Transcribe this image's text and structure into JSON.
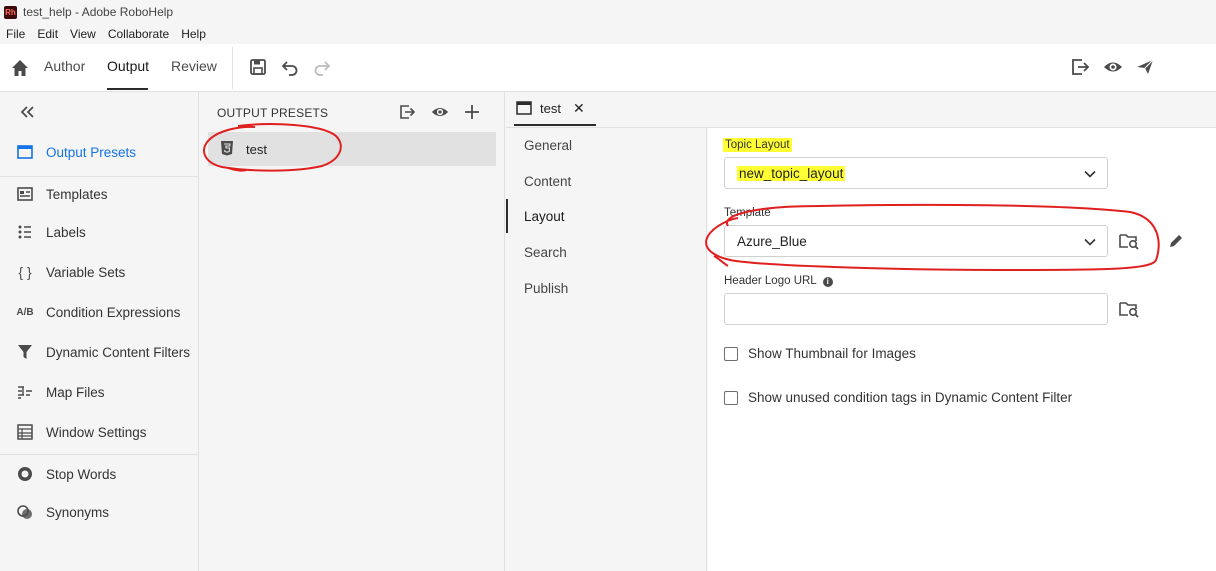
{
  "window": {
    "title": "test_help - Adobe RoboHelp",
    "logo_text": "Rh"
  },
  "menu": [
    "File",
    "Edit",
    "View",
    "Collaborate",
    "Help"
  ],
  "toolbar": {
    "tabs": [
      "Author",
      "Output",
      "Review"
    ],
    "active_tab": "Output"
  },
  "left_rail": {
    "items": [
      {
        "label": "Output Presets",
        "icon": "output-presets-icon",
        "active": true
      },
      {
        "label": "Templates",
        "icon": "templates-icon"
      },
      {
        "label": "Labels",
        "icon": "labels-icon"
      },
      {
        "label": "Variable Sets",
        "icon": "braces-icon",
        "glyph": "{ }"
      },
      {
        "label": "Condition Expressions",
        "icon": "ab-icon",
        "glyph": "A/B"
      },
      {
        "label": "Dynamic Content Filters",
        "icon": "filter-icon"
      },
      {
        "label": "Map Files",
        "icon": "map-files-icon"
      },
      {
        "label": "Window Settings",
        "icon": "window-settings-icon"
      },
      {
        "label": "Stop Words",
        "icon": "stop-words-icon"
      },
      {
        "label": "Synonyms",
        "icon": "synonyms-icon"
      }
    ]
  },
  "presets_panel": {
    "title": "OUTPUT PRESETS",
    "presets": [
      {
        "label": "test",
        "icon": "html5-icon"
      }
    ]
  },
  "editor": {
    "tab": {
      "label": "test",
      "close": "✕"
    },
    "nav": [
      "General",
      "Content",
      "Layout",
      "Search",
      "Publish"
    ],
    "active_nav": "Layout",
    "topic_layout": {
      "label": "Topic Layout",
      "value": "new_topic_layout"
    },
    "template": {
      "label": "Template",
      "value": "Azure_Blue"
    },
    "header_logo_url": {
      "label": "Header Logo URL",
      "value": ""
    },
    "checkboxes": [
      {
        "label": "Show Thumbnail for Images",
        "checked": false
      },
      {
        "label": "Show unused condition tags in Dynamic Content Filter",
        "checked": false
      }
    ]
  },
  "colors": {
    "accent": "#1473e6",
    "highlight": "#ffff33",
    "annotation": "#e02020"
  }
}
